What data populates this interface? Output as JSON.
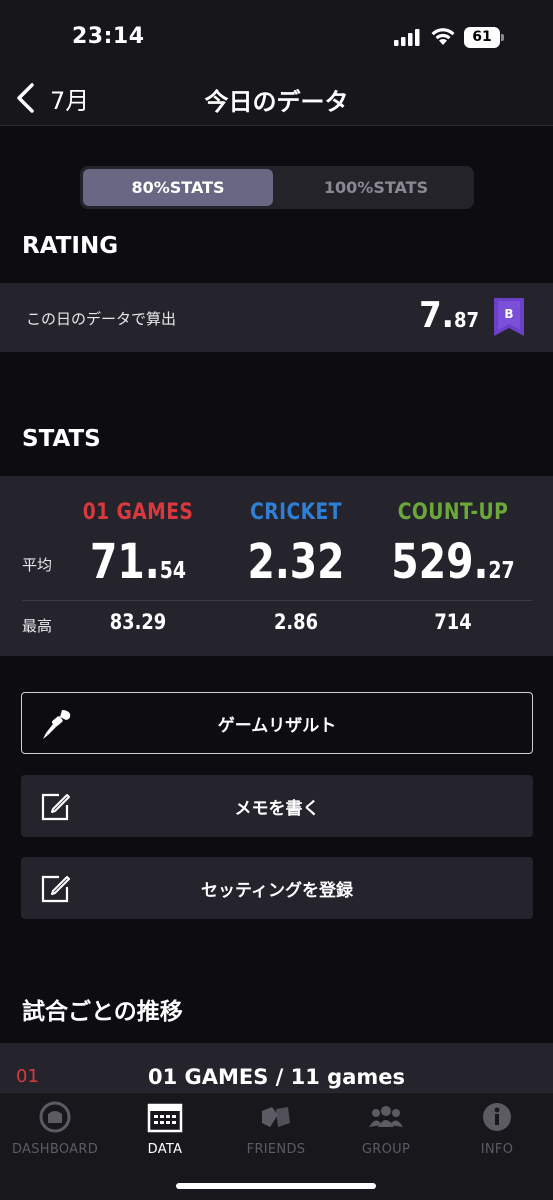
{
  "status_bar": {
    "time": "23:14",
    "battery": "61"
  },
  "nav": {
    "back_label": "7月",
    "title": "今日のデータ"
  },
  "segmented": {
    "active": "80%STATS",
    "inactive": "100%STATS"
  },
  "rating": {
    "section_title": "RATING",
    "label": "この日のデータで算出",
    "value_int": "7.",
    "value_dec": "87",
    "badge": "B",
    "badge_color": "#6b3fc7"
  },
  "stats": {
    "section_title": "STATS",
    "avg_label": "平均",
    "max_label": "最高",
    "columns": [
      {
        "name": "01 GAMES",
        "color": "#d9383d",
        "avg_int": "71.",
        "avg_dec": "54",
        "max": "83.29"
      },
      {
        "name": "CRICKET",
        "color": "#2f7fd6",
        "avg_int": "2.32",
        "avg_dec": "",
        "max": "2.86"
      },
      {
        "name": "COUNT-UP",
        "color": "#6aa83a",
        "avg_int": "529.",
        "avg_dec": "27",
        "max": "714"
      }
    ]
  },
  "actions": {
    "game_result": "ゲームリザルト",
    "write_memo": "メモを書く",
    "register_setting": "セッティングを登録"
  },
  "transition": {
    "section_title": "試合ごとの推移",
    "code": "01",
    "title": "01 GAMES / 11 games"
  },
  "tabs": [
    {
      "label": "DASHBOARD",
      "icon": "dashboard-icon"
    },
    {
      "label": "DATA",
      "icon": "data-icon"
    },
    {
      "label": "FRIENDS",
      "icon": "friends-icon"
    },
    {
      "label": "GROUP",
      "icon": "group-icon"
    },
    {
      "label": "INFO",
      "icon": "info-icon"
    }
  ]
}
